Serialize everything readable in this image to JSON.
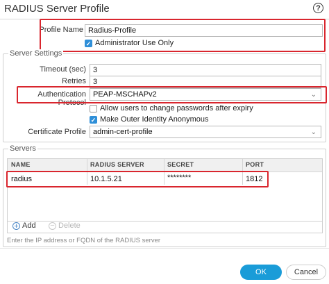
{
  "dialog": {
    "title": "RADIUS Server Profile",
    "help_glyph": "?"
  },
  "profile": {
    "name_label": "Profile Name",
    "name_value": "Radius-Profile",
    "admin_use_only_label": "Administrator Use Only",
    "admin_use_only_checked": true
  },
  "server_settings": {
    "legend": "Server Settings",
    "timeout_label": "Timeout (sec)",
    "timeout_value": "3",
    "retries_label": "Retries",
    "retries_value": "3",
    "auth_protocol_label": "Authentication Protocol",
    "auth_protocol_value": "PEAP-MSCHAPv2",
    "allow_change_pw_label": "Allow users to change passwords after expiry",
    "allow_change_pw_checked": false,
    "outer_identity_label": "Make Outer Identity Anonymous",
    "outer_identity_checked": true,
    "cert_profile_label": "Certificate Profile",
    "cert_profile_value": "admin-cert-profile"
  },
  "servers": {
    "legend": "Servers",
    "columns": [
      "NAME",
      "RADIUS SERVER",
      "SECRET",
      "PORT"
    ],
    "rows": [
      {
        "name": "radius",
        "server": "10.1.5.21",
        "secret": "********",
        "port": "1812"
      }
    ],
    "add_label": "Add",
    "delete_label": "Delete",
    "hint": "Enter the IP address or FQDN of the RADIUS server"
  },
  "buttons": {
    "ok": "OK",
    "cancel": "Cancel"
  },
  "colors": {
    "highlight": "#d9262e",
    "accent": "#1a9cd8",
    "check": "#2f8fd8"
  },
  "icons": {
    "help": "help-icon",
    "add": "plus-circle-icon",
    "delete": "minus-circle-icon",
    "dropdown": "chevron-down-icon",
    "checkmark": "check-icon"
  }
}
